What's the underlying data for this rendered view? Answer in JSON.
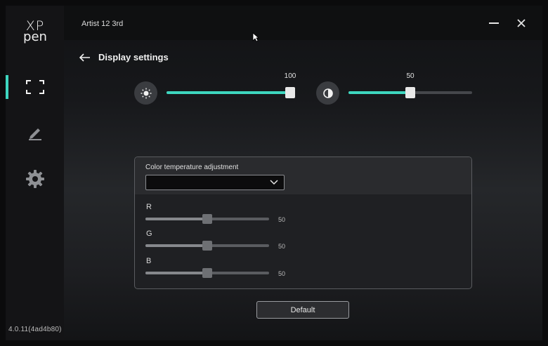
{
  "sidebar": {
    "logo_line1": "XP",
    "logo_line2": "pen",
    "items": [
      {
        "name": "display",
        "icon": "fullscreen-icon",
        "active": true
      },
      {
        "name": "pen",
        "icon": "pen-icon",
        "active": false
      },
      {
        "name": "settings",
        "icon": "gear-icon",
        "active": false
      }
    ],
    "version": "4.0.11(4ad4b80)"
  },
  "titlebar": {
    "title": "Artist 12 3rd",
    "minimize_icon": "minimize-icon",
    "close_icon": "close-icon"
  },
  "header": {
    "back_icon": "arrow-left-icon",
    "title": "Display settings"
  },
  "brightness": {
    "icon": "sun-icon",
    "value": 100,
    "value_label": "100",
    "min": 0,
    "max": 100
  },
  "contrast": {
    "icon": "contrast-icon",
    "value": 50,
    "value_label": "50",
    "min": 0,
    "max": 100
  },
  "color_temperature": {
    "label": "Color temperature adjustment",
    "selected": "",
    "channels": [
      {
        "label": "R",
        "value": 50,
        "value_label": "50"
      },
      {
        "label": "G",
        "value": 50,
        "value_label": "50"
      },
      {
        "label": "B",
        "value": 50,
        "value_label": "50"
      }
    ]
  },
  "default_button": "Default",
  "colors": {
    "accent": "#3ed6bf",
    "sidebar_bg": "#141416",
    "track": "#45474b"
  }
}
